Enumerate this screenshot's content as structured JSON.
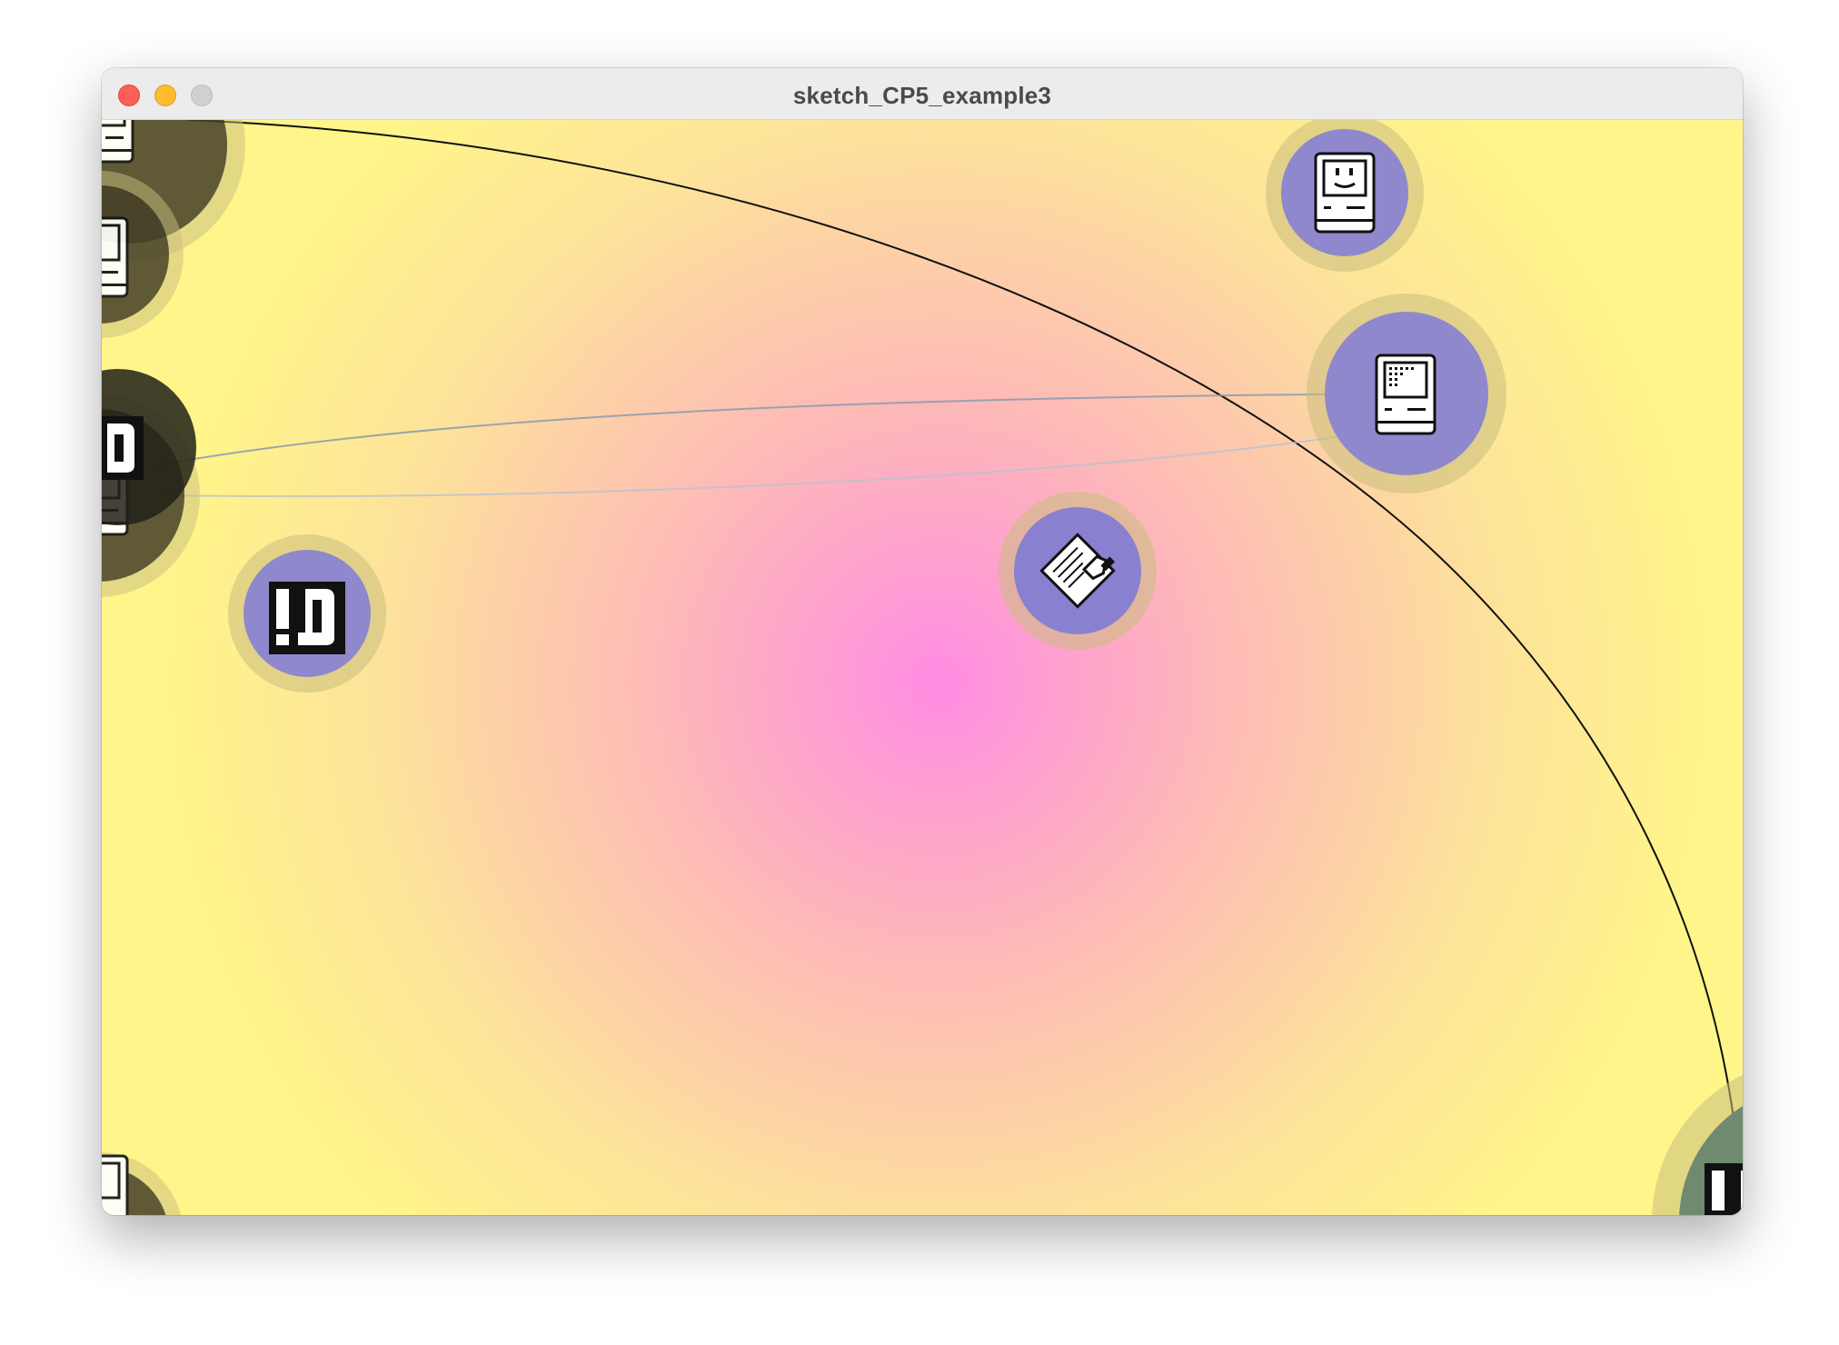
{
  "window": {
    "title": "sketch_CP5_example3",
    "buttons": [
      "close",
      "minimize",
      "zoom"
    ]
  },
  "canvas": {
    "background_center_color": "#ff8ce3",
    "background_edge_color": "#fff58a",
    "node_fill_color": "#8f88cc",
    "node_faded_fill_color": "#3a3620",
    "node_halo_color": "#c8bd7e",
    "node_green_fill_color": "#6f8a6e",
    "arc_color": "#111111",
    "link_color": "#8a9ab0",
    "nodes": [
      {
        "icon": "computer-smile-icon"
      },
      {
        "icon": "computer-screen-icon"
      },
      {
        "icon": "document-pen-icon"
      },
      {
        "icon": "app-bang-icon"
      },
      {
        "icon": "computer-screen-icon"
      },
      {
        "icon": "computer-screen-icon"
      },
      {
        "icon": "app-bang-icon"
      },
      {
        "icon": "computer-screen-icon"
      },
      {
        "icon": "computer-screen-icon"
      },
      {
        "icon": "app-bang-icon"
      }
    ]
  }
}
